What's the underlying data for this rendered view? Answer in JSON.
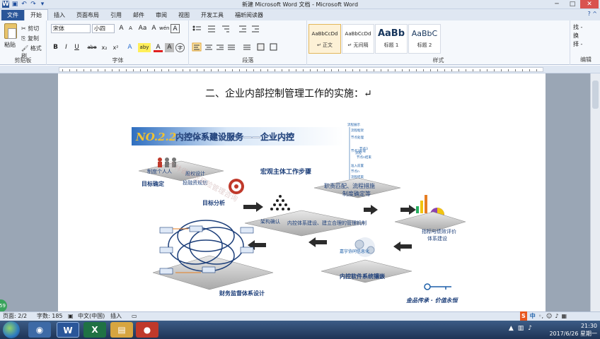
{
  "window": {
    "title": "新建 Microsoft Word 文档 - Microsoft Word",
    "controls": [
      "minimize",
      "maximize",
      "close"
    ]
  },
  "ribbon_tabs": [
    "文件",
    "开始",
    "插入",
    "页面布局",
    "引用",
    "邮件",
    "审阅",
    "视图",
    "开发工具",
    "福昕阅读器"
  ],
  "clipboard": {
    "paste": "粘贴",
    "cut": "剪切",
    "copy": "复制",
    "format_painter": "格式刷",
    "group": "剪贴板"
  },
  "font": {
    "name": "宋体",
    "size": "小四",
    "group": "字体",
    "grow": "A",
    "shrink": "A",
    "case": "Aa",
    "clear": "A",
    "pinyin": "wén",
    "border": "A",
    "bold": "B",
    "italic": "I",
    "underline": "U",
    "strike": "abe",
    "sub": "x₂",
    "sup": "x²",
    "effects": "A",
    "highlight": "aby",
    "color": "A",
    "shade": "A",
    "circle": "字"
  },
  "paragraph": {
    "group": "段落"
  },
  "styles": {
    "group": "样式",
    "items": [
      {
        "sample": "AaBbCcDd",
        "label": "↵ 正文"
      },
      {
        "sample": "AaBbCcDd",
        "label": "↵ 无间隔"
      },
      {
        "sample": "AaBb",
        "label": "标题 1"
      },
      {
        "sample": "AaBbC",
        "label": "标题 2"
      }
    ]
  },
  "editing": {
    "find": "找 -",
    "replace": "换",
    "select": "择 -",
    "group": "编辑"
  },
  "document": {
    "heading": "二、企业内部控制管理工作的实施：↵"
  },
  "figure": {
    "banner_badge": "NO.2.2",
    "banner_title": "内控体系建设服务——企业内控",
    "steps": [
      "制度个人人",
      "股权设计",
      "投融资规划",
      "宏观主体工作步骤",
      "目标确定",
      "目标分析",
      "职责匹配、流程措施",
      "制度确定等",
      "架构确认",
      "内控体系建设、建立合理的管理机制",
      "指标与绩效评价",
      "体系建设",
      "财务监督体系设计",
      "内控软件系统镶嵌",
      "嘉宇协同信息化"
    ],
    "flow": [
      "流程展示",
      "流程框架",
      "节点处理",
      "节点3",
      "节点3处理",
      "节点n结束",
      "准入前置",
      "节点n",
      "流程结束",
      "流程"
    ],
    "watermark": "吉林省企业风险管理咨询",
    "slogan": "金品传承 · 价值永恒"
  },
  "status_bar": {
    "page": "页面: 2/2",
    "words": "字数: 185",
    "lang": "中文(中国)",
    "mode": "插入",
    "zoom_badge": "59"
  },
  "taskbar": {
    "apps": [
      "W",
      "X"
    ],
    "time": "21:30",
    "date": "2017/6/26 星期一",
    "ime": "中"
  }
}
